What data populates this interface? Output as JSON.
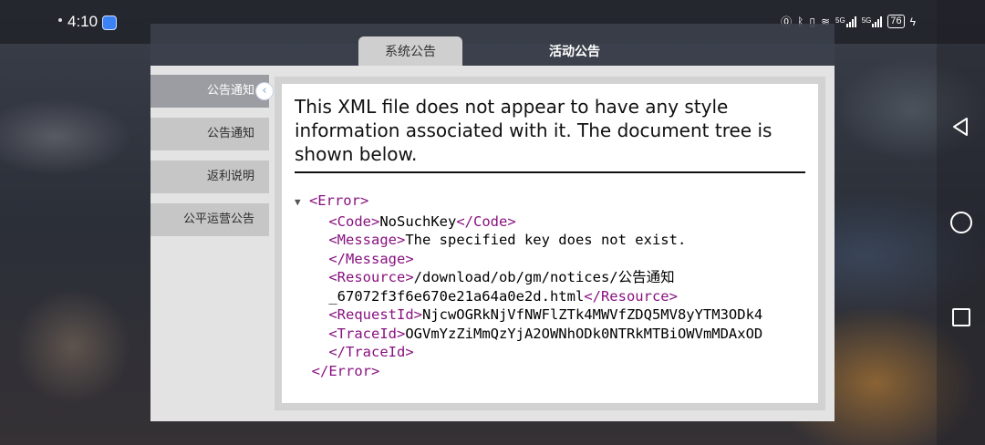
{
  "status_bar": {
    "time": "4:10",
    "network_5g_1": "5G",
    "network_5g_2": "5G",
    "battery": "76"
  },
  "tabs": [
    {
      "label": "系统公告",
      "active": true
    },
    {
      "label": "活动公告",
      "active": false
    }
  ],
  "sidebar": {
    "items": [
      {
        "label": "公告通知",
        "active": true
      },
      {
        "label": "公告通知",
        "active": false
      },
      {
        "label": "返利说明",
        "active": false
      },
      {
        "label": "公平运营公告",
        "active": false
      }
    ]
  },
  "xml_viewer": {
    "notice": "This XML file does not appear to have any style information associated with it. The document tree is shown below.",
    "toggle": "▼",
    "error_open": "<Error>",
    "code_open": "<Code>",
    "code_value": "NoSuchKey",
    "code_close": "</Code>",
    "message_open": "<Message>",
    "message_value": "The specified key does not exist.",
    "message_close": "</Message>",
    "resource_open": "<Resource>",
    "resource_value_1": "/download/ob/gm/notices/公告通知",
    "resource_value_2": "_67072f3f6e670e21a64a0e2d.html",
    "resource_close": "</Resource>",
    "requestid_open": "<RequestId>",
    "requestid_value": "NjcwOGRkNjVfNWFlZTk4MWVfZDQ5MV8yYTM3ODk4",
    "traceid_open": "<TraceId>",
    "traceid_value": "OGVmYzZiMmQzYjA2OWNhODk0NTRkMTBiOWVmMDAxOD",
    "traceid_close": "</TraceId>",
    "error_close": "</Error>"
  }
}
